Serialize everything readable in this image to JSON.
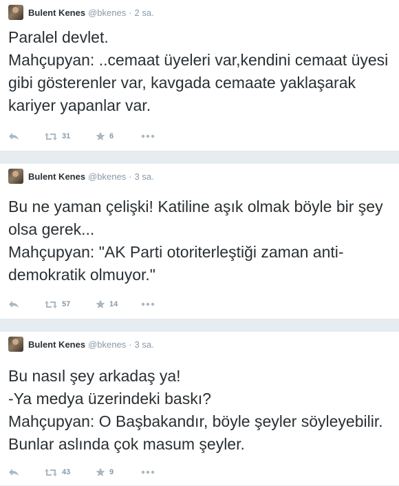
{
  "tweets": [
    {
      "author_name": "Bulent Kenes",
      "handle": "@bkenes",
      "separator": "·",
      "time": "2 sa.",
      "text": "Paralel devlet.\nMahçupyan: ..cemaat üyeleri var,kendini cemaat üyesi gibi gösterenler var, kavgada cemaate yaklaşarak kariyer yapanlar var.",
      "retweets": "31",
      "favorites": "6"
    },
    {
      "author_name": "Bulent Kenes",
      "handle": "@bkenes",
      "separator": "·",
      "time": "3 sa.",
      "text": "Bu ne yaman çelişki! Katiline aşık olmak böyle bir şey olsa gerek...\nMahçupyan: \"AK Parti otoriterleştiği zaman anti-demokratik olmuyor.\"",
      "retweets": "57",
      "favorites": "14"
    },
    {
      "author_name": "Bulent Kenes",
      "handle": "@bkenes",
      "separator": "·",
      "time": "3 sa.",
      "text": "Bu nasıl şey arkadaş ya!\n-Ya medya üzerindeki baskı?\nMahçupyan: O Başbakandır, böyle şeyler söyleyebilir. Bunlar aslında çok masum şeyler.",
      "retweets": "43",
      "favorites": "9"
    }
  ],
  "colors": {
    "text": "#292f33",
    "meta": "#8899a6",
    "icon": "#aab8c2",
    "divider": "#e6ecf0"
  },
  "icons": [
    "reply-icon",
    "retweet-icon",
    "favorite-star-icon",
    "more-icon"
  ]
}
